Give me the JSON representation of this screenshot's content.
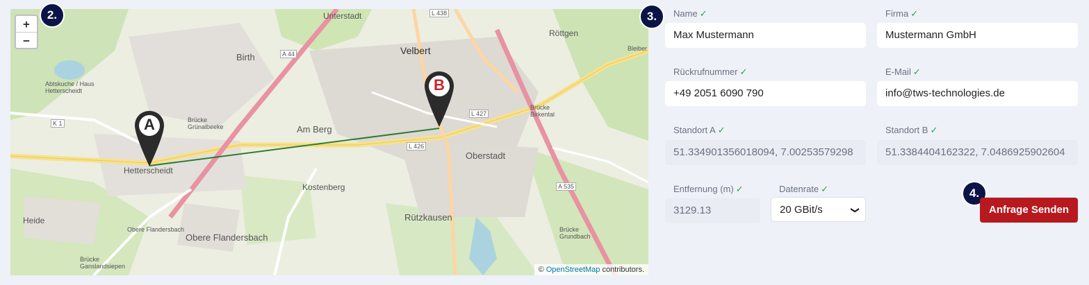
{
  "map": {
    "zoom_in": "+",
    "zoom_out": "−",
    "attribution_prefix": "©",
    "attribution_link": "OpenStreetMap",
    "attribution_suffix": "contributors.",
    "marker_a": "A",
    "marker_b": "B",
    "places": {
      "unterstadt": "Unterstadt",
      "velbert": "Velbert",
      "birth": "Birth",
      "rottgen": "Röttgen",
      "bleiber": "Bleiber",
      "am_berg": "Am Berg",
      "hetterscheidt": "Hetterscheidt",
      "kostenberg": "Kostenberg",
      "oberstadt": "Oberstadt",
      "heide": "Heide",
      "rutzkausen": "Rützkausen",
      "obere_flandersbach": "Obere Flandersbach",
      "obere_flandersbach_small": "Obere Flandersbach",
      "bruecke_grunal": "Brücke Grünalbeeke",
      "bruecke_birk": "Brücke Birkental",
      "bruecke_grund": "Brücke Grundbach",
      "bruecke_gans": "Brücke Ganslandsiepen",
      "abtskuche": "Abtskuche / Haus Hetterscheidt",
      "a44": "A 44",
      "a535": "A 535",
      "l426": "L 426",
      "l427": "L 427",
      "l438": "L 438",
      "k1": "K 1"
    }
  },
  "steps": {
    "map": "2.",
    "form": "3.",
    "send": "4."
  },
  "form": {
    "name": {
      "label": "Name",
      "value": "Max Mustermann"
    },
    "company": {
      "label": "Firma",
      "value": "Mustermann GmbH"
    },
    "callback": {
      "label": "Rückrufnummer",
      "value": "+49 2051 6090 790"
    },
    "email": {
      "label": "E-Mail",
      "value": "info@tws-technologies.de"
    },
    "site_a": {
      "label": "Standort A",
      "value": "51.334901356018094, 7.00253579298"
    },
    "site_b": {
      "label": "Standort B",
      "value": "51.3384404162322, 7.0486925902604"
    },
    "distance": {
      "label": "Entfernung (m)",
      "value": "3129.13"
    },
    "datarate": {
      "label": "Datenrate",
      "value": "20 GBit/s"
    },
    "check": "✓",
    "submit": "Anfrage Senden"
  },
  "colors": {
    "accent": "#b8191f",
    "badge": "#0c1447",
    "check": "#22a35a",
    "link_line": "#2e7d32"
  }
}
